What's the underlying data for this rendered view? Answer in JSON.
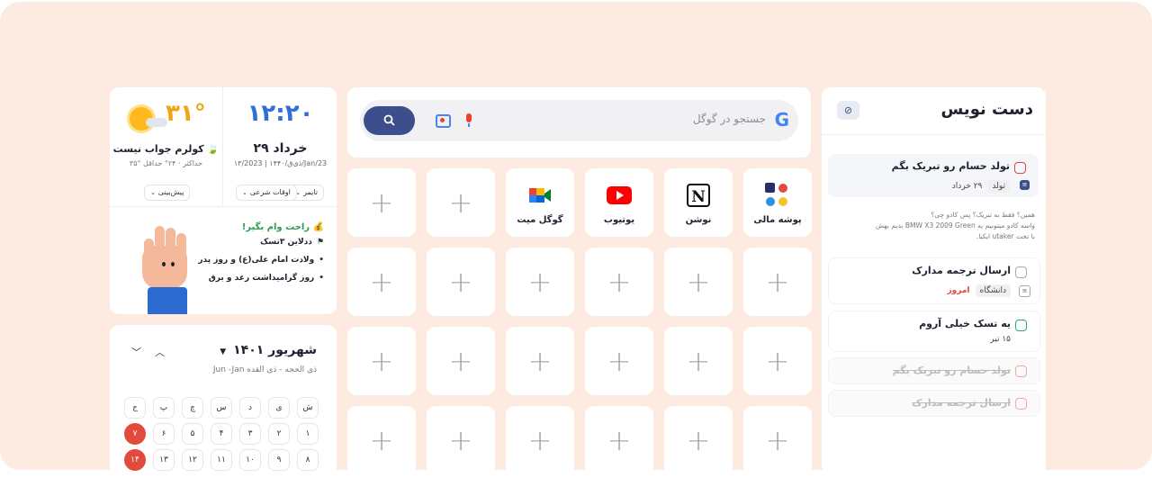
{
  "clock": {
    "time": "۱۲:۲۰",
    "date": "۲۹ خرداد",
    "date_sub": "۱۳/ذی‌ق/۱۴۴۰ | 2023/Jan/23",
    "temp": "۳۱°",
    "weather_text": "کولرم جواب نیست",
    "minmax": "۳۵° حداکثر  ·  ۲۴° حداقل",
    "chips": {
      "timer": "تایمر",
      "prayer": "اوقات شرعی",
      "forecast": "پیش‌بینی"
    }
  },
  "loan": {
    "heading": "راحت وام بگیر!",
    "items": [
      "ددلاین ۳تسک",
      "ولادت امام علی(ع) و روز پدر",
      "روز گرامیداشت رعد و برق"
    ]
  },
  "calendar": {
    "month": "شهریور ۱۴۰۱",
    "sub": "ذی الحجه - ذی القده  Jun -Jan",
    "weekdays": [
      "ش",
      "ی",
      "د",
      "س",
      "چ",
      "پ",
      "ج"
    ],
    "row1": [
      "۱",
      "۲",
      "۳",
      "۴",
      "۵",
      "۶",
      "۷"
    ],
    "row2": [
      "۸",
      "۹",
      "۱۰",
      "۱۱",
      "۱۲",
      "۱۳",
      "۱۴"
    ]
  },
  "search": {
    "placeholder": "جستجو در گوگل"
  },
  "shortcuts": {
    "finance": "پوشه مالی",
    "notion": "نوشن",
    "youtube": "یوتیوب",
    "meet": "گوگل میت"
  },
  "notes": {
    "title": "دست نویس",
    "tasks": [
      {
        "title": "تولد حسام رو تبریک بگم",
        "tag": "تولد",
        "date": "۲۹ خرداد"
      },
      {
        "title": "ارسال ترجمه مدارک",
        "tag": "دانشگاه",
        "date": "امروز"
      },
      {
        "title": "یه تسک خیلی آروم",
        "date": "۱۵ تیر"
      }
    ],
    "desc_1": "همین؟ فقط به تبریک؟ پس کادو چی؟",
    "desc_2": "واسه کادو میتونیم یه BMW X3 2009 Green بدیم بهش",
    "desc_3": "با تخت utaker ایکیا.",
    "done": [
      "تولد حسام رو تبریک بگم",
      "ارسال ترجمه مدارک"
    ]
  },
  "colors": {
    "accent": "#3c4f8c",
    "clock": "#2f6fd6",
    "temp": "#f0a613",
    "today": "#e24a3b",
    "background": "#fdebe1"
  }
}
